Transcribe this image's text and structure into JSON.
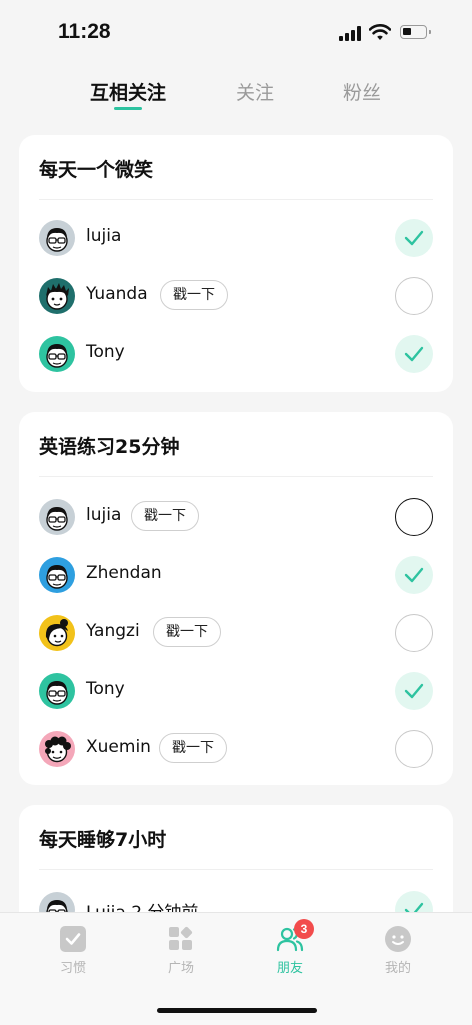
{
  "status": {
    "time": "11:28"
  },
  "tabs": [
    {
      "label": "互相关注",
      "active": true
    },
    {
      "label": "关注",
      "active": false
    },
    {
      "label": "粉丝",
      "active": false
    }
  ],
  "cards": [
    {
      "title": "每天一个微笑",
      "rows": [
        {
          "name": "lujia",
          "poke": "",
          "checked": true
        },
        {
          "name": "Yuanda",
          "poke": "戳一下",
          "checked": false
        },
        {
          "name": "Tony",
          "poke": "",
          "checked": true
        }
      ]
    },
    {
      "title": "英语练习25分钟",
      "rows": [
        {
          "name": "lujia",
          "poke": "戳一下",
          "checked": false
        },
        {
          "name": "Zhendan",
          "poke": "",
          "checked": true
        },
        {
          "name": "Yangzi",
          "poke": "戳一下",
          "checked": false
        },
        {
          "name": "Tony",
          "poke": "",
          "checked": true
        },
        {
          "name": "Xuemin",
          "poke": "戳一下",
          "checked": false
        }
      ]
    },
    {
      "title": "每天睡够7小时",
      "rows": [
        {
          "name": "Lujia 2 分钟前",
          "poke": "",
          "checked": true
        }
      ]
    }
  ],
  "tabbar": [
    {
      "label": "习惯",
      "icon": "habit-icon",
      "active": false
    },
    {
      "label": "广场",
      "icon": "square-icon",
      "active": false
    },
    {
      "label": "朋友",
      "icon": "friends-icon",
      "active": true,
      "badge": "3"
    },
    {
      "label": "我的",
      "icon": "profile-icon",
      "active": false
    }
  ],
  "colors": {
    "accent": "#2ec3a0",
    "check_bg": "#e2f7f0",
    "badge": "#f24c4c"
  }
}
